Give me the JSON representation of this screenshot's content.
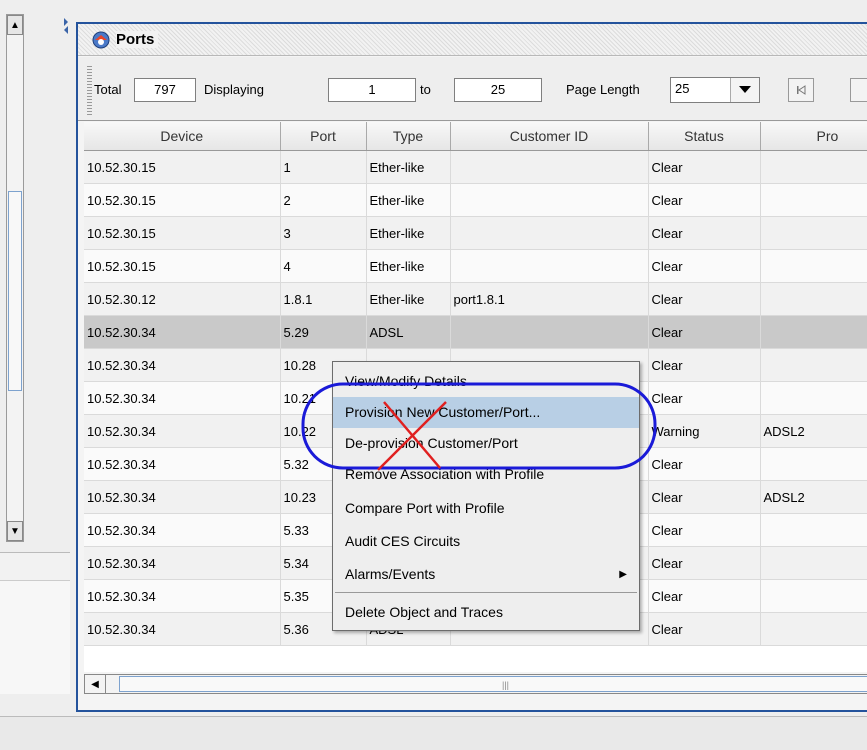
{
  "window": {
    "title": "Ports"
  },
  "toolbar": {
    "total_label": "Total",
    "total_value": "797",
    "displaying_label": "Displaying",
    "from_value": "1",
    "to_label": "to",
    "to_value": "25",
    "page_length_label": "Page Length",
    "page_length_value": "25"
  },
  "table": {
    "columns": [
      "Device",
      "Port",
      "Type",
      "Customer ID",
      "Status",
      "Pro"
    ],
    "rows": [
      [
        "10.52.30.15",
        "1",
        "Ether-like",
        "",
        "Clear",
        ""
      ],
      [
        "10.52.30.15",
        "2",
        "Ether-like",
        "",
        "Clear",
        ""
      ],
      [
        "10.52.30.15",
        "3",
        "Ether-like",
        "",
        "Clear",
        ""
      ],
      [
        "10.52.30.15",
        "4",
        "Ether-like",
        "",
        "Clear",
        ""
      ],
      [
        "10.52.30.12",
        "1.8.1",
        "Ether-like",
        "port1.8.1",
        "Clear",
        ""
      ],
      [
        "10.52.30.34",
        "5.29",
        "ADSL",
        "",
        "Clear",
        ""
      ],
      [
        "10.52.30.34",
        "10.28",
        "",
        "",
        "Clear",
        ""
      ],
      [
        "10.52.30.34",
        "10.21",
        "",
        "",
        "Clear",
        ""
      ],
      [
        "10.52.30.34",
        "10.22",
        "",
        "",
        "Warning",
        "ADSL2"
      ],
      [
        "10.52.30.34",
        "5.32",
        "",
        "",
        "Clear",
        ""
      ],
      [
        "10.52.30.34",
        "10.23",
        "",
        "",
        "Clear",
        "ADSL2"
      ],
      [
        "10.52.30.34",
        "5.33",
        "",
        "",
        "Clear",
        ""
      ],
      [
        "10.52.30.34",
        "5.34",
        "",
        "",
        "Clear",
        ""
      ],
      [
        "10.52.30.34",
        "5.35",
        "ADSL",
        "",
        "Clear",
        ""
      ],
      [
        "10.52.30.34",
        "5.36",
        "ADSL",
        "",
        "Clear",
        ""
      ]
    ],
    "selected_row_index": 5
  },
  "context_menu": {
    "items": [
      {
        "label": "View/Modify Details"
      },
      {
        "label": "Provision New Customer/Port..."
      },
      {
        "label": "De-provision Customer/Port"
      },
      {
        "label": "Remove Association with Profile"
      },
      {
        "label": "Compare Port with Profile"
      },
      {
        "label": "Audit CES Circuits"
      },
      {
        "label": "Alarms/Events"
      },
      {
        "label": "Delete Object and Traces"
      }
    ],
    "highlighted_index": 1
  },
  "colors": {
    "window_border": "#24539c",
    "menu_highlight": "#b8cfe5",
    "annotation_circle": "#1a1ad8",
    "annotation_cross": "#e02020"
  },
  "icons": {
    "title": "ports-icon",
    "dropdown": "triangle-down-icon",
    "first_page": "first-page-icon",
    "submenu": "submenu-arrow-icon"
  }
}
